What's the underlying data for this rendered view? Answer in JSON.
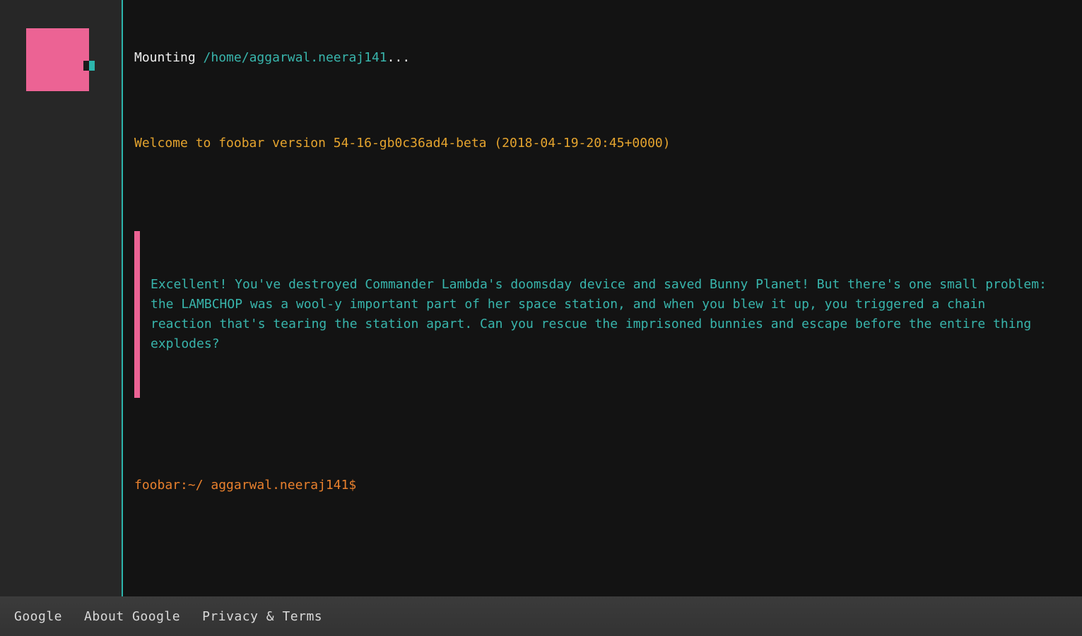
{
  "sidebar": {
    "logo": "foobar-logo"
  },
  "terminal": {
    "mounting_prefix": "Mounting ",
    "mounting_path": "/home/aggarwal.neeraj141",
    "mounting_suffix": "...",
    "welcome": "Welcome to foobar version 54-16-gb0c36ad4-beta (2018-04-19-20:45+0000)",
    "quote": "Excellent! You've destroyed Commander Lambda's doomsday device and saved Bunny Planet! But there's one small problem:\nthe LAMBCHOP was a wool-y important part of her space station, and when you blew it up, you triggered a chain\nreaction that's tearing the station apart. Can you rescue the imprisoned bunnies and escape before the entire thing\nexplodes?",
    "prompt": "foobar:~/ aggarwal.neeraj141$"
  },
  "footer": {
    "items": [
      {
        "label": "Google"
      },
      {
        "label": "About Google"
      },
      {
        "label": "Privacy & Terms"
      }
    ]
  },
  "colors": {
    "pink": "#ec6394",
    "teal": "#2cb5ac",
    "teal_text": "#38b5ac",
    "amber": "#e5a42e",
    "orange": "#e8802d",
    "sidebar_bg": "#272727",
    "terminal_bg": "#131313",
    "footer_bg": "#3a3a3a",
    "footer_text": "#d9d9d9",
    "white_text": "#efefef"
  }
}
